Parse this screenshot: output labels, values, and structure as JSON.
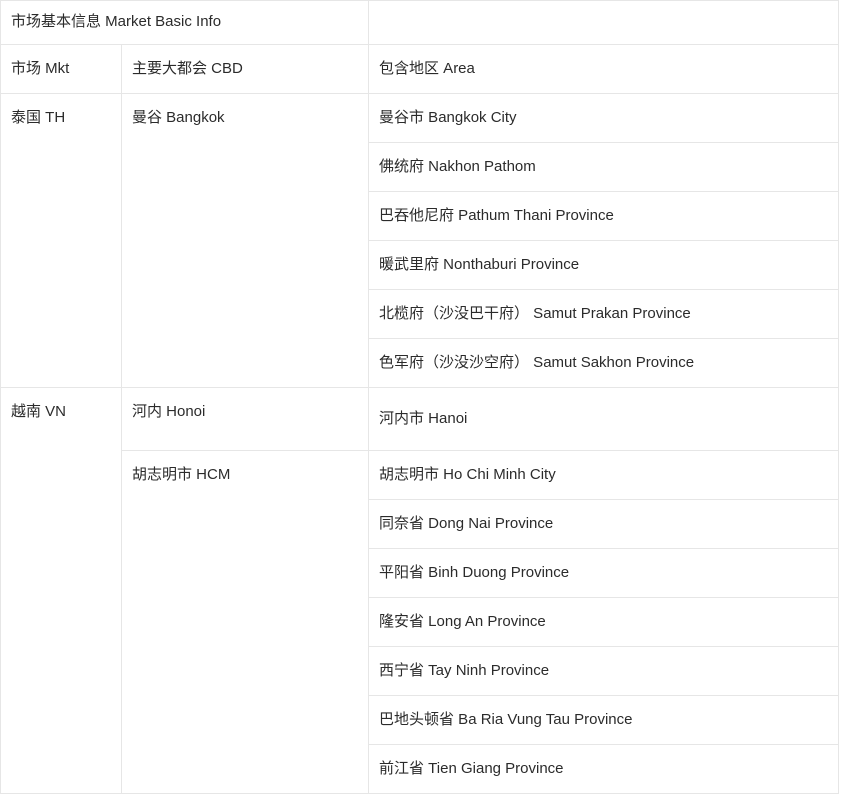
{
  "table": {
    "title": "市场基本信息 Market Basic Info",
    "title_empty_cell": "",
    "columns": {
      "market": "市场 Mkt",
      "cbd": "主要大都会 CBD",
      "area": "包含地区 Area"
    },
    "markets": [
      {
        "market": "泰国 TH",
        "cbds": [
          {
            "cbd": "曼谷 Bangkok",
            "areas": [
              "曼谷市 Bangkok City",
              "佛统府 Nakhon Pathom",
              "巴吞他尼府 Pathum Thani Province",
              "暖武里府 Nonthaburi Province",
              "北榄府（沙没巴干府） Samut Prakan Province",
              "色军府（沙没沙空府） Samut Sakhon Province"
            ]
          }
        ]
      },
      {
        "market": "越南 VN",
        "cbds": [
          {
            "cbd": "河内 Honoi",
            "areas": [
              "河内市 Hanoi"
            ]
          },
          {
            "cbd": "胡志明市 HCM",
            "areas": [
              "胡志明市 Ho Chi Minh City",
              "同奈省 Dong Nai Province",
              "平阳省 Binh Duong Province",
              "隆安省 Long An Province",
              "西宁省 Tay Ninh Province",
              "巴地头顿省 Ba Ria Vung Tau Province",
              "前江省 Tien Giang Province"
            ]
          }
        ]
      }
    ],
    "colors": {
      "border": "#e6e6e6",
      "text": "#2b2b2b",
      "background": "#ffffff"
    }
  }
}
